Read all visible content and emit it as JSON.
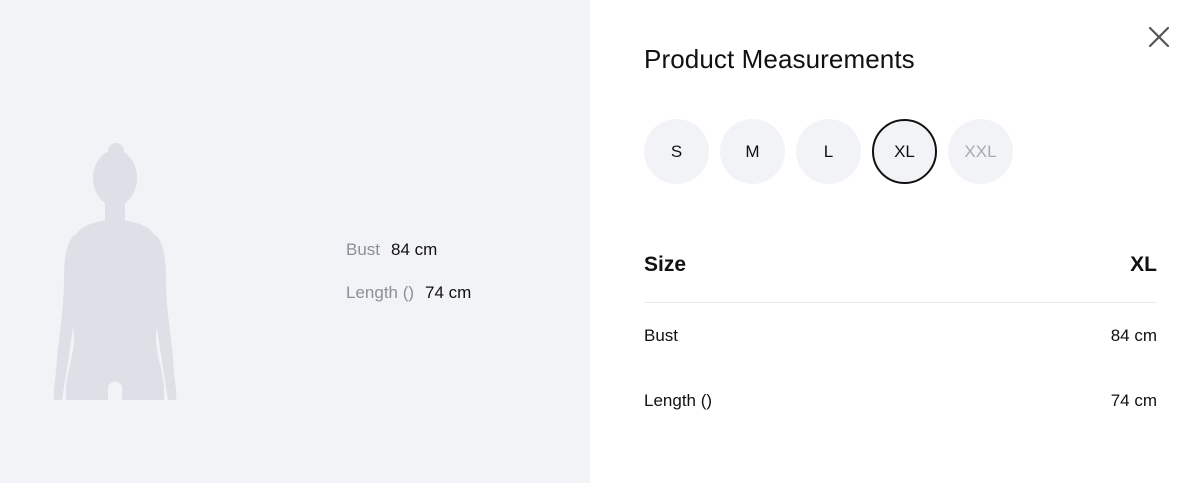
{
  "title": "Product Measurements",
  "sizes": [
    {
      "label": "S",
      "state": "available"
    },
    {
      "label": "M",
      "state": "available"
    },
    {
      "label": "L",
      "state": "available"
    },
    {
      "label": "XL",
      "state": "selected"
    },
    {
      "label": "XXL",
      "state": "disabled"
    }
  ],
  "overlay": {
    "rows": [
      {
        "label": "Bust",
        "value": "84 cm"
      },
      {
        "label": "Length ()",
        "value": "74 cm"
      }
    ]
  },
  "table": {
    "header_label": "Size",
    "header_value": "XL",
    "rows": [
      {
        "label": "Bust",
        "value": "84 cm"
      },
      {
        "label": "Length ()",
        "value": "74 cm"
      }
    ]
  },
  "icons": {
    "close": "close-icon",
    "figure": "body-silhouette-icon"
  },
  "colors": {
    "panel_bg": "#f2f3f7",
    "silhouette": "#dfe0e7",
    "muted_text": "#8e8e98",
    "disabled_text": "#a9a9b2",
    "selected_border": "#111111"
  }
}
